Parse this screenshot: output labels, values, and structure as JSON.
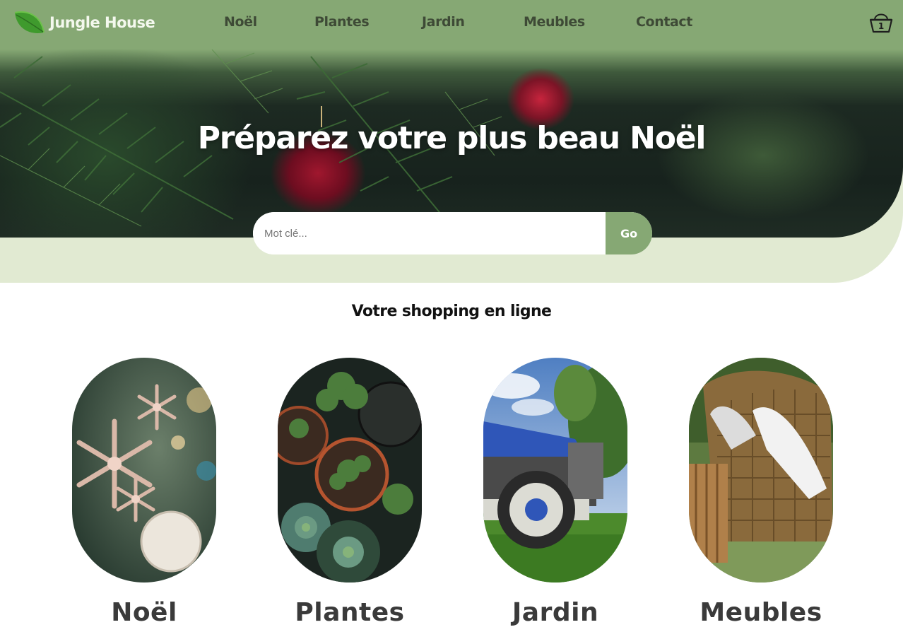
{
  "header": {
    "brand": "Jungle House",
    "nav": [
      {
        "label": "Noël"
      },
      {
        "label": "Plantes"
      },
      {
        "label": "Jardin"
      },
      {
        "label": "Meubles"
      },
      {
        "label": "Contact"
      }
    ],
    "cart_count": "1"
  },
  "hero": {
    "title": "Préparez votre plus beau Noël",
    "search": {
      "placeholder": "Mot clé...",
      "value": "",
      "button_label": "Go"
    }
  },
  "shop": {
    "title": "Votre shopping en ligne",
    "categories": [
      {
        "label": "Noël"
      },
      {
        "label": "Plantes"
      },
      {
        "label": "Jardin"
      },
      {
        "label": "Meubles"
      }
    ]
  },
  "colors": {
    "header_green": "#86a874",
    "hero_band": "#e1ead2",
    "nav_text": "#3e4a36",
    "button_green": "#86a874"
  }
}
